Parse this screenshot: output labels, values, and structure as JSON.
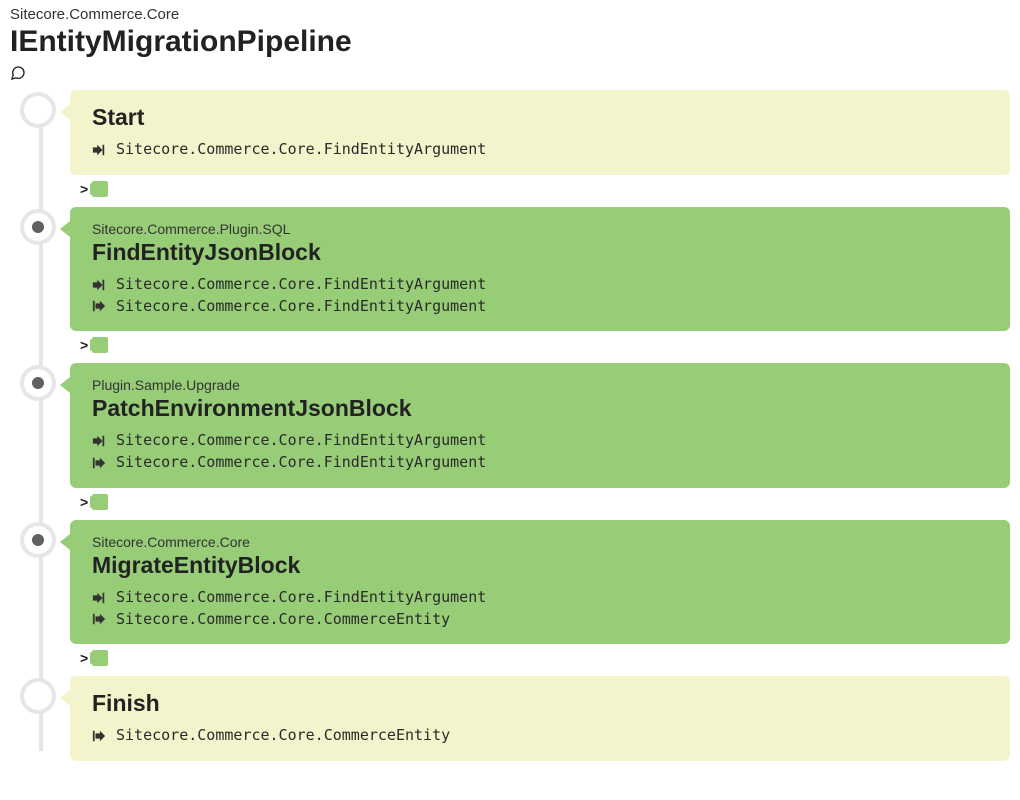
{
  "header": {
    "namespace": "Sitecore.Commerce.Core",
    "title": "IEntityMigrationPipeline"
  },
  "blocks": [
    {
      "kind": "terminal",
      "title": "Start",
      "io": [
        {
          "dir": "in",
          "type": "Sitecore.Commerce.Core.FindEntityArgument"
        }
      ],
      "expand": true
    },
    {
      "kind": "step",
      "namespace": "Sitecore.Commerce.Plugin.SQL",
      "title": "FindEntityJsonBlock",
      "io": [
        {
          "dir": "in",
          "type": "Sitecore.Commerce.Core.FindEntityArgument"
        },
        {
          "dir": "out",
          "type": "Sitecore.Commerce.Core.FindEntityArgument"
        }
      ],
      "expand": true
    },
    {
      "kind": "step",
      "namespace": "Plugin.Sample.Upgrade",
      "title": "PatchEnvironmentJsonBlock",
      "io": [
        {
          "dir": "in",
          "type": "Sitecore.Commerce.Core.FindEntityArgument"
        },
        {
          "dir": "out",
          "type": "Sitecore.Commerce.Core.FindEntityArgument"
        }
      ],
      "expand": true
    },
    {
      "kind": "step",
      "namespace": "Sitecore.Commerce.Core",
      "title": "MigrateEntityBlock",
      "io": [
        {
          "dir": "in",
          "type": "Sitecore.Commerce.Core.FindEntityArgument"
        },
        {
          "dir": "out",
          "type": "Sitecore.Commerce.Core.CommerceEntity"
        }
      ],
      "expand": true
    },
    {
      "kind": "terminal",
      "title": "Finish",
      "io": [
        {
          "dir": "out",
          "type": "Sitecore.Commerce.Core.CommerceEntity"
        }
      ],
      "expand": false
    }
  ]
}
